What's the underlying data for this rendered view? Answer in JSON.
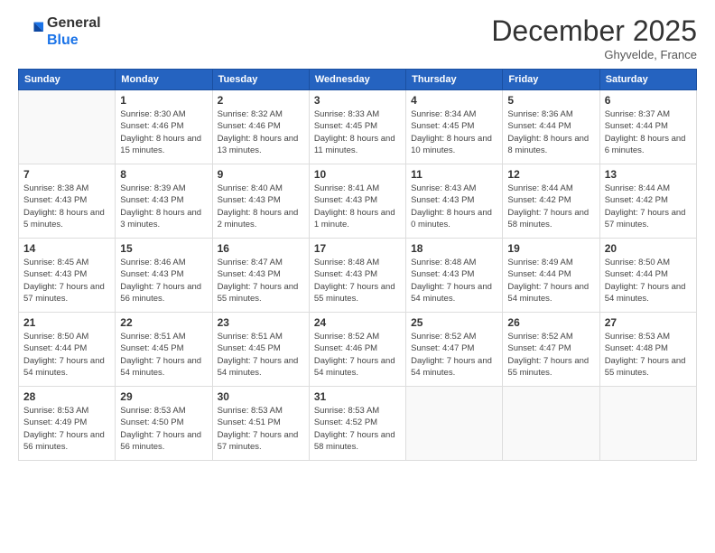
{
  "logo": {
    "general": "General",
    "blue": "Blue"
  },
  "title": "December 2025",
  "location": "Ghyvelde, France",
  "headers": [
    "Sunday",
    "Monday",
    "Tuesday",
    "Wednesday",
    "Thursday",
    "Friday",
    "Saturday"
  ],
  "weeks": [
    [
      {
        "day": "",
        "sunrise": "",
        "sunset": "",
        "daylight": ""
      },
      {
        "day": "1",
        "sunrise": "Sunrise: 8:30 AM",
        "sunset": "Sunset: 4:46 PM",
        "daylight": "Daylight: 8 hours and 15 minutes."
      },
      {
        "day": "2",
        "sunrise": "Sunrise: 8:32 AM",
        "sunset": "Sunset: 4:46 PM",
        "daylight": "Daylight: 8 hours and 13 minutes."
      },
      {
        "day": "3",
        "sunrise": "Sunrise: 8:33 AM",
        "sunset": "Sunset: 4:45 PM",
        "daylight": "Daylight: 8 hours and 11 minutes."
      },
      {
        "day": "4",
        "sunrise": "Sunrise: 8:34 AM",
        "sunset": "Sunset: 4:45 PM",
        "daylight": "Daylight: 8 hours and 10 minutes."
      },
      {
        "day": "5",
        "sunrise": "Sunrise: 8:36 AM",
        "sunset": "Sunset: 4:44 PM",
        "daylight": "Daylight: 8 hours and 8 minutes."
      },
      {
        "day": "6",
        "sunrise": "Sunrise: 8:37 AM",
        "sunset": "Sunset: 4:44 PM",
        "daylight": "Daylight: 8 hours and 6 minutes."
      }
    ],
    [
      {
        "day": "7",
        "sunrise": "Sunrise: 8:38 AM",
        "sunset": "Sunset: 4:43 PM",
        "daylight": "Daylight: 8 hours and 5 minutes."
      },
      {
        "day": "8",
        "sunrise": "Sunrise: 8:39 AM",
        "sunset": "Sunset: 4:43 PM",
        "daylight": "Daylight: 8 hours and 3 minutes."
      },
      {
        "day": "9",
        "sunrise": "Sunrise: 8:40 AM",
        "sunset": "Sunset: 4:43 PM",
        "daylight": "Daylight: 8 hours and 2 minutes."
      },
      {
        "day": "10",
        "sunrise": "Sunrise: 8:41 AM",
        "sunset": "Sunset: 4:43 PM",
        "daylight": "Daylight: 8 hours and 1 minute."
      },
      {
        "day": "11",
        "sunrise": "Sunrise: 8:43 AM",
        "sunset": "Sunset: 4:43 PM",
        "daylight": "Daylight: 8 hours and 0 minutes."
      },
      {
        "day": "12",
        "sunrise": "Sunrise: 8:44 AM",
        "sunset": "Sunset: 4:42 PM",
        "daylight": "Daylight: 7 hours and 58 minutes."
      },
      {
        "day": "13",
        "sunrise": "Sunrise: 8:44 AM",
        "sunset": "Sunset: 4:42 PM",
        "daylight": "Daylight: 7 hours and 57 minutes."
      }
    ],
    [
      {
        "day": "14",
        "sunrise": "Sunrise: 8:45 AM",
        "sunset": "Sunset: 4:43 PM",
        "daylight": "Daylight: 7 hours and 57 minutes."
      },
      {
        "day": "15",
        "sunrise": "Sunrise: 8:46 AM",
        "sunset": "Sunset: 4:43 PM",
        "daylight": "Daylight: 7 hours and 56 minutes."
      },
      {
        "day": "16",
        "sunrise": "Sunrise: 8:47 AM",
        "sunset": "Sunset: 4:43 PM",
        "daylight": "Daylight: 7 hours and 55 minutes."
      },
      {
        "day": "17",
        "sunrise": "Sunrise: 8:48 AM",
        "sunset": "Sunset: 4:43 PM",
        "daylight": "Daylight: 7 hours and 55 minutes."
      },
      {
        "day": "18",
        "sunrise": "Sunrise: 8:48 AM",
        "sunset": "Sunset: 4:43 PM",
        "daylight": "Daylight: 7 hours and 54 minutes."
      },
      {
        "day": "19",
        "sunrise": "Sunrise: 8:49 AM",
        "sunset": "Sunset: 4:44 PM",
        "daylight": "Daylight: 7 hours and 54 minutes."
      },
      {
        "day": "20",
        "sunrise": "Sunrise: 8:50 AM",
        "sunset": "Sunset: 4:44 PM",
        "daylight": "Daylight: 7 hours and 54 minutes."
      }
    ],
    [
      {
        "day": "21",
        "sunrise": "Sunrise: 8:50 AM",
        "sunset": "Sunset: 4:44 PM",
        "daylight": "Daylight: 7 hours and 54 minutes."
      },
      {
        "day": "22",
        "sunrise": "Sunrise: 8:51 AM",
        "sunset": "Sunset: 4:45 PM",
        "daylight": "Daylight: 7 hours and 54 minutes."
      },
      {
        "day": "23",
        "sunrise": "Sunrise: 8:51 AM",
        "sunset": "Sunset: 4:45 PM",
        "daylight": "Daylight: 7 hours and 54 minutes."
      },
      {
        "day": "24",
        "sunrise": "Sunrise: 8:52 AM",
        "sunset": "Sunset: 4:46 PM",
        "daylight": "Daylight: 7 hours and 54 minutes."
      },
      {
        "day": "25",
        "sunrise": "Sunrise: 8:52 AM",
        "sunset": "Sunset: 4:47 PM",
        "daylight": "Daylight: 7 hours and 54 minutes."
      },
      {
        "day": "26",
        "sunrise": "Sunrise: 8:52 AM",
        "sunset": "Sunset: 4:47 PM",
        "daylight": "Daylight: 7 hours and 55 minutes."
      },
      {
        "day": "27",
        "sunrise": "Sunrise: 8:53 AM",
        "sunset": "Sunset: 4:48 PM",
        "daylight": "Daylight: 7 hours and 55 minutes."
      }
    ],
    [
      {
        "day": "28",
        "sunrise": "Sunrise: 8:53 AM",
        "sunset": "Sunset: 4:49 PM",
        "daylight": "Daylight: 7 hours and 56 minutes."
      },
      {
        "day": "29",
        "sunrise": "Sunrise: 8:53 AM",
        "sunset": "Sunset: 4:50 PM",
        "daylight": "Daylight: 7 hours and 56 minutes."
      },
      {
        "day": "30",
        "sunrise": "Sunrise: 8:53 AM",
        "sunset": "Sunset: 4:51 PM",
        "daylight": "Daylight: 7 hours and 57 minutes."
      },
      {
        "day": "31",
        "sunrise": "Sunrise: 8:53 AM",
        "sunset": "Sunset: 4:52 PM",
        "daylight": "Daylight: 7 hours and 58 minutes."
      },
      {
        "day": "",
        "sunrise": "",
        "sunset": "",
        "daylight": ""
      },
      {
        "day": "",
        "sunrise": "",
        "sunset": "",
        "daylight": ""
      },
      {
        "day": "",
        "sunrise": "",
        "sunset": "",
        "daylight": ""
      }
    ]
  ]
}
